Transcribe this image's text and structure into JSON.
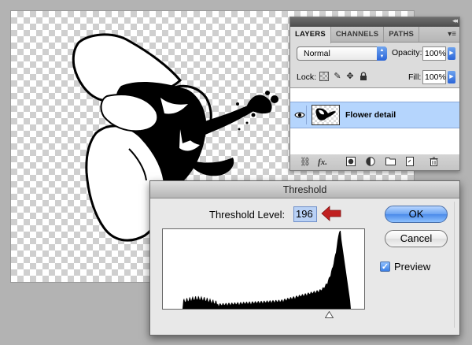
{
  "canvas": {
    "checker_color": "#cfcfcf",
    "artwork": "hibiscus flower (threshold applied)"
  },
  "layers_panel": {
    "tabs": [
      {
        "label": "LAYERS",
        "active": true
      },
      {
        "label": "CHANNELS",
        "active": false
      },
      {
        "label": "PATHS",
        "active": false
      }
    ],
    "blend_mode": "Normal",
    "opacity_label": "Opacity:",
    "opacity_value": "100%",
    "lock_label": "Lock:",
    "fill_label": "Fill:",
    "fill_value": "100%",
    "layers": [
      {
        "name": "Flower detail",
        "visible": true,
        "selected": true
      }
    ],
    "bottom_icons": [
      "link-icon",
      "fx-icon",
      "mask-icon",
      "adjustment-icon",
      "group-folder-icon",
      "new-layer-icon",
      "trash-icon"
    ],
    "fx_glyph": "fx.",
    "selection_color": "#b5d5fd"
  },
  "threshold_dialog": {
    "title": "Threshold",
    "level_label": "Threshold Level:",
    "level_value": "196",
    "ok_label": "OK",
    "cancel_label": "Cancel",
    "preview_label": "Preview",
    "preview_checked": true,
    "slider_value": 196,
    "histogram": {
      "bins": 256,
      "peak_bin": 226
    },
    "arrow_color": "#c02020"
  }
}
